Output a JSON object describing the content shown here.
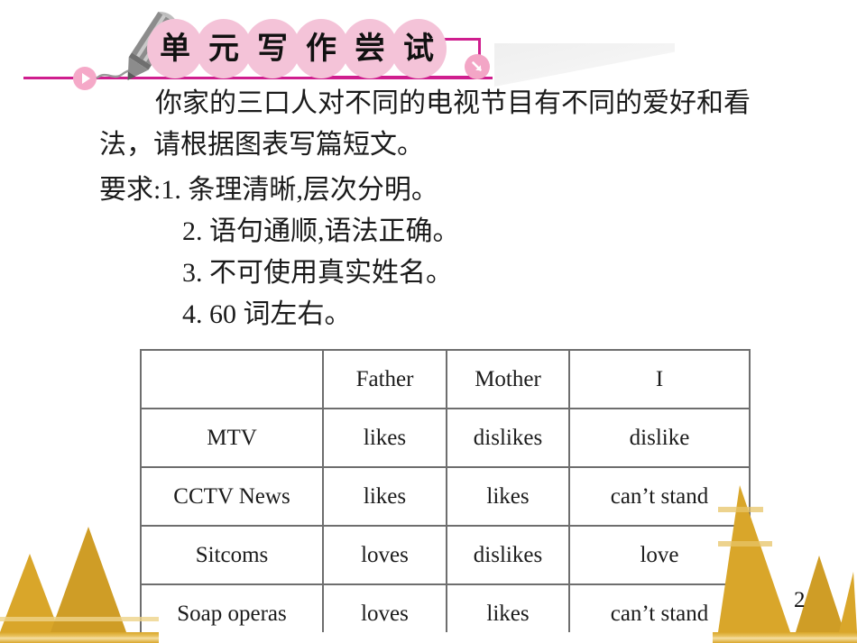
{
  "header": {
    "title_chars": [
      "单",
      "元",
      "写",
      "作",
      "尝",
      "试"
    ],
    "title_full": "单元写作尝试",
    "icons": {
      "pencil": "pencil-icon",
      "play_badge": "play-circle-icon",
      "arrow_badge": "arrow-down-right-circle-icon"
    },
    "colors": {
      "circle_pink": "#f4c3d8",
      "line_magenta": "#cf1e8e",
      "badge_pink": "#f3a6c6"
    }
  },
  "body": {
    "paragraph": "你家的三口人对不同的电视节目有不同的爱好和看法，请根据图表写篇短文。",
    "requirements_label": "要求:",
    "requirements": [
      "1. 条理清晰,层次分明。",
      "2. 语句通顺,语法正确。",
      "3. 不可使用真实姓名。",
      "4. 60 词左右。"
    ],
    "req_first_line": "要求:1. 条理清晰,层次分明。"
  },
  "table": {
    "headers": [
      "",
      "Father",
      "Mother",
      "I"
    ],
    "rows": [
      {
        "program": "MTV",
        "father": "likes",
        "mother": "dislikes",
        "i": "dislike"
      },
      {
        "program": "CCTV News",
        "father": "likes",
        "mother": "likes",
        "i": "can’t stand"
      },
      {
        "program": "Sitcoms",
        "father": "loves",
        "mother": "dislikes",
        "i": "love"
      },
      {
        "program": "Soap operas",
        "father": "loves",
        "mother": "likes",
        "i": "can’t stand"
      }
    ]
  },
  "footer": {
    "page_number": "2",
    "decoration_color": "#d9a62a"
  }
}
